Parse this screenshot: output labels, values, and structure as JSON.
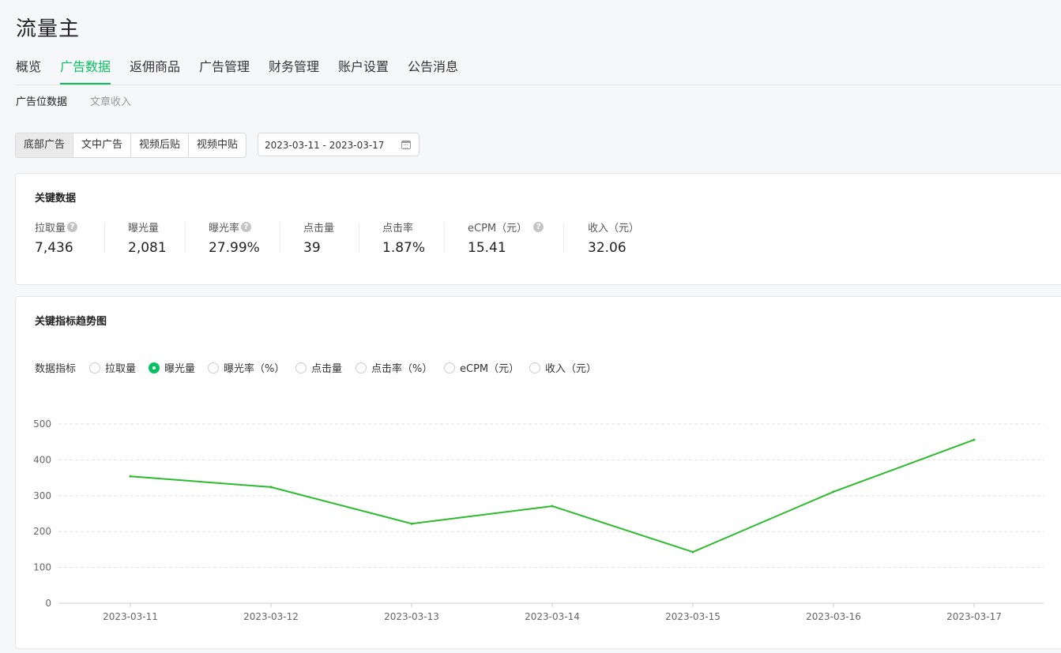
{
  "app_title": "流量主",
  "main_nav": [
    "概览",
    "广告数据",
    "返佣商品",
    "广告管理",
    "财务管理",
    "账户设置",
    "公告消息"
  ],
  "main_nav_active": "广告数据",
  "sub_nav": [
    "广告位数据",
    "文章收入"
  ],
  "sub_nav_active": "广告位数据",
  "ad_types": [
    "底部广告",
    "文中广告",
    "视频后贴",
    "视频中贴"
  ],
  "ad_type_active": "底部广告",
  "date_range": "2023-03-11 - 2023-03-17",
  "key_data": {
    "title": "关键数据",
    "metrics": [
      {
        "label": "拉取量",
        "value": "7,436",
        "help": true
      },
      {
        "label": "曝光量",
        "value": "2,081",
        "help": false
      },
      {
        "label": "曝光率",
        "value": "27.99%",
        "help": true
      },
      {
        "label": "点击量",
        "value": "39",
        "help": false
      },
      {
        "label": "点击率",
        "value": "1.87%",
        "help": false
      },
      {
        "label": "eCPM（元）",
        "value": "15.41",
        "help": true
      },
      {
        "label": "收入（元）",
        "value": "32.06",
        "help": false
      }
    ]
  },
  "trend": {
    "title": "关键指标趋势图",
    "indicator_label": "数据指标",
    "indicators": [
      "拉取量",
      "曝光量",
      "曝光率（%）",
      "点击量",
      "点击率（%）",
      "eCPM（元）",
      "收入（元）"
    ],
    "selected": "曝光量"
  },
  "colors": {
    "accent": "#07c160",
    "line": "#2dbb2d"
  },
  "chart_data": {
    "type": "line",
    "categories": [
      "2023-03-11",
      "2023-03-12",
      "2023-03-13",
      "2023-03-14",
      "2023-03-15",
      "2023-03-16",
      "2023-03-17"
    ],
    "series": [
      {
        "values": [
          354,
          324,
          222,
          271,
          143,
          311,
          456
        ]
      }
    ],
    "ylim": [
      0,
      500
    ],
    "yticks": [
      0,
      100,
      200,
      300,
      400,
      500
    ],
    "grid": true
  }
}
